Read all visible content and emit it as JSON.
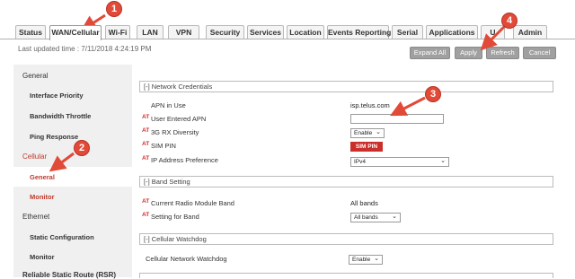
{
  "tabs": [
    {
      "label": "Status"
    },
    {
      "label": "WAN/Cellular"
    },
    {
      "label": "Wi-Fi"
    },
    {
      "label": "LAN"
    },
    {
      "label": "VPN"
    },
    {
      "label": "Security"
    },
    {
      "label": "Services"
    },
    {
      "label": "Location"
    },
    {
      "label": "Events Reporting"
    },
    {
      "label": "Serial"
    },
    {
      "label": "Applications"
    },
    {
      "label": "U"
    },
    {
      "label": "Admin"
    }
  ],
  "header": {
    "last_updated": "Last updated time : 7/11/2018 4:24:19 PM",
    "expand_all": "Expand All",
    "apply": "Apply",
    "refresh": "Refresh",
    "cancel": "Cancel"
  },
  "sidebar": {
    "general": "General",
    "interface_priority": "Interface Priority",
    "bandwidth_throttle": "Bandwidth Throttle",
    "ping_response": "Ping Response",
    "cellular": "Cellular",
    "cellular_general": "General",
    "monitor": "Monitor",
    "ethernet": "Ethernet",
    "static_configuration": "Static Configuration",
    "ethernet_monitor": "Monitor",
    "reliable_static_route": "Reliable Static Route (RSR)"
  },
  "main": {
    "network_credentials": "[-] Network Credentials",
    "apn_in_use_label": "APN in Use",
    "apn_in_use_value": "isp.telus.com",
    "at": "AT",
    "user_entered_apn": "User Entered APN",
    "rx_diversity": "3G RX Diversity",
    "rx_diversity_value": "Enable",
    "sim_pin": "SIM PIN",
    "sim_pin_button": "SIM PIN",
    "ip_address_pref": "IP Address Preference",
    "ip_address_pref_value": "IPv4",
    "band_setting": "[-] Band Setting",
    "current_band": "Current Radio Module Band",
    "current_band_value": "All bands",
    "setting_for_band": "Setting for Band",
    "setting_for_band_value": "All bands",
    "cellular_watchdog": "[-] Cellular Watchdog",
    "network_watchdog": "Cellular Network Watchdog",
    "network_watchdog_value": "Enable"
  },
  "annotations": [
    "1",
    "2",
    "3",
    "4"
  ],
  "colors": {
    "annotation": "#e14a38",
    "at_text": "#d02c2c",
    "sim_pin": "#c9302c",
    "active_nav": "#c0392b"
  }
}
